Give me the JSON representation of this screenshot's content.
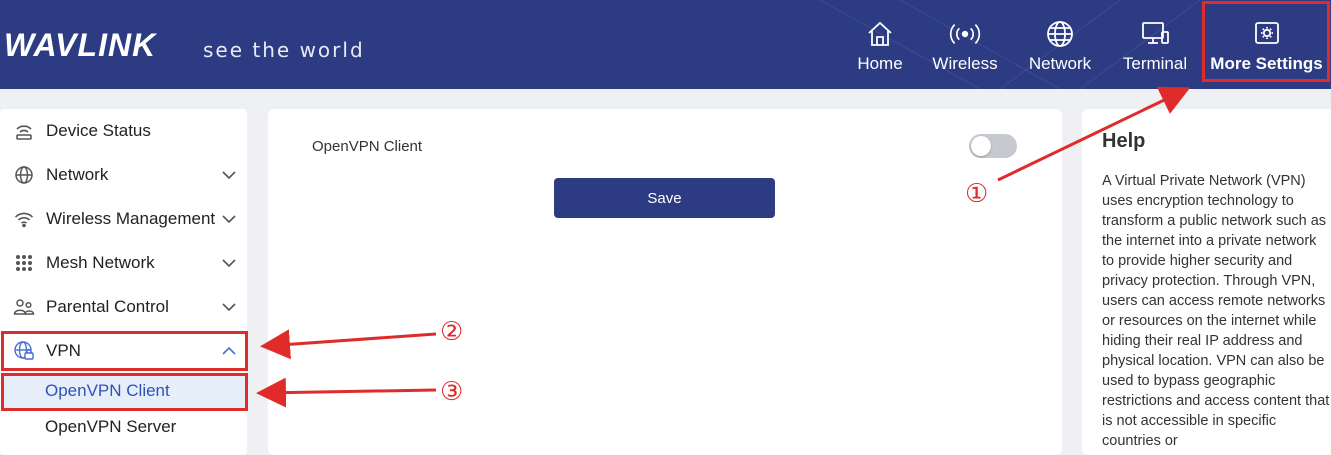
{
  "header": {
    "logo": "WAVLINK",
    "slogan": "see the world",
    "nav": [
      {
        "label": "Home",
        "icon": "home-icon"
      },
      {
        "label": "Wireless",
        "icon": "wireless-icon"
      },
      {
        "label": "Network",
        "icon": "globe-icon"
      },
      {
        "label": "Terminal",
        "icon": "terminal-icon"
      },
      {
        "label": "More Settings",
        "icon": "settings-icon",
        "active": true
      }
    ]
  },
  "sidebar": {
    "items": [
      {
        "label": "Device Status",
        "icon": "device-status-icon",
        "expandable": false
      },
      {
        "label": "Network",
        "icon": "globe-icon",
        "expandable": true
      },
      {
        "label": "Wireless Management",
        "icon": "wifi-icon",
        "expandable": true
      },
      {
        "label": "Mesh Network",
        "icon": "mesh-grid-icon",
        "expandable": true
      },
      {
        "label": "Parental Control",
        "icon": "parental-control-icon",
        "expandable": true
      },
      {
        "label": "VPN",
        "icon": "vpn-icon",
        "expandable": true,
        "expanded": true
      }
    ],
    "subitems": [
      {
        "label": "OpenVPN Client",
        "active": true
      },
      {
        "label": "OpenVPN Server",
        "active": false
      }
    ]
  },
  "main": {
    "field_label": "OpenVPN Client",
    "toggle_on": false,
    "save_label": "Save"
  },
  "help": {
    "title": "Help",
    "text": "A Virtual Private Network (VPN) uses encryption technology to transform a public network such as the internet into a private network to provide higher security and privacy protection. Through VPN, users can access remote networks or resources on the internet while hiding their real IP address and physical location. VPN can also be used to bypass geographic restrictions and access content that is not accessible in specific countries or"
  },
  "annotations": {
    "step1": "①",
    "step2": "②",
    "step3": "③"
  },
  "colors": {
    "header_bg": "#2c3b82",
    "accent": "#2f52b8",
    "annotation_red": "#e02b2b",
    "active_sub_bg": "#e6eefa"
  }
}
